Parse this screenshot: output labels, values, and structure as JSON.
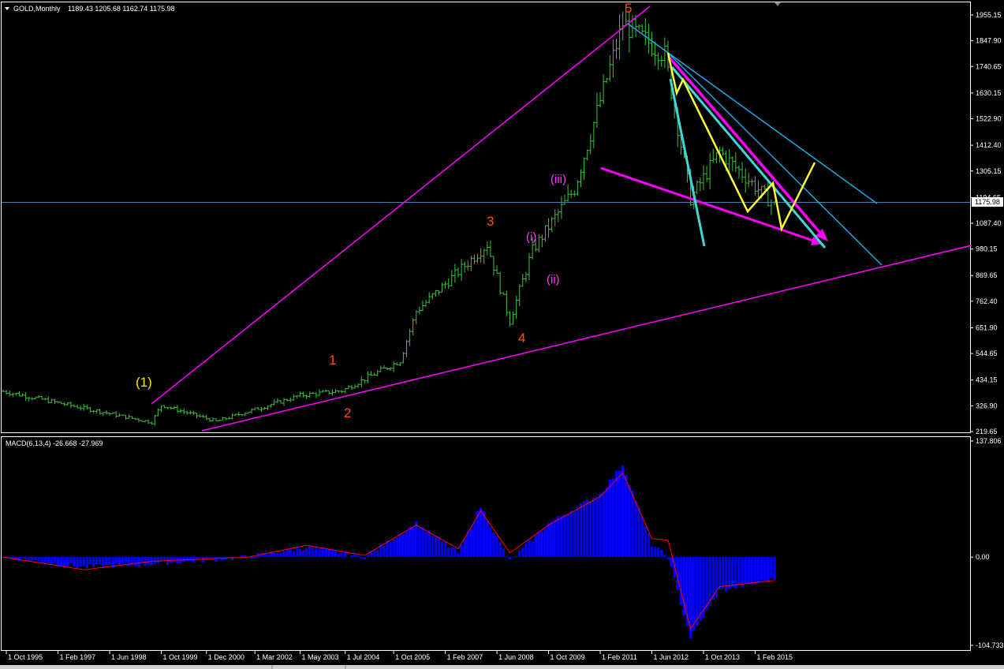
{
  "header": {
    "symbol": "GOLD,Monthly",
    "ohlc": "1189.43 1205.68 1162.74 1175.98",
    "macd_label": "MACD(6,13,4) -26.668 -27.969"
  },
  "colors": {
    "background": "#000000",
    "bar": "#3fbf3f",
    "grid_border": "#ffffff",
    "magenta": "#ff00ff",
    "light_blue": "#1ea7e6",
    "cyan": "#3fd8d8",
    "yellow": "#ffff33",
    "orange_label": "#ff4c1a",
    "yellow_label": "#ffe600",
    "macd_hist": "#0000ff",
    "macd_signal": "#ff0000",
    "current_price_line": "#4682b4"
  },
  "price_axis": {
    "ticks": [
      "1955.15",
      "1847.90",
      "1740.65",
      "1630.15",
      "1522.90",
      "1412.40",
      "1305.15",
      "1194.65",
      "1087.40",
      "980.15",
      "869.65",
      "762.40",
      "651.90",
      "544.65",
      "434.15",
      "326.90",
      "219.65"
    ],
    "current_price": "1175.98"
  },
  "macd_axis": {
    "ticks": [
      "137.806",
      "0.00",
      "-104.733"
    ]
  },
  "time_axis": {
    "labels": [
      "1 Oct 1995",
      "1 Feb 1997",
      "1 Jun 1998",
      "1 Oct 1999",
      "1 Dec 2000",
      "1 Mar 2002",
      "1 May 2003",
      "1 Jul 2004",
      "1 Oct 2005",
      "1 Feb 2007",
      "1 Jun 2008",
      "1 Oct 2009",
      "1 Feb 2011",
      "1 Jun 2012",
      "1 Oct 2013",
      "1 Feb 2015"
    ]
  },
  "wave_labels": {
    "w1_major": "(1)",
    "w1": "1",
    "w2": "2",
    "w3": "3",
    "w4": "4",
    "w5": "5",
    "wi": "(i)",
    "wii": "(ii)",
    "wiii": "(iii)"
  },
  "chart_data": [
    {
      "type": "bar",
      "title": "GOLD,Monthly",
      "x_range": [
        "1995-09",
        "2015-08"
      ],
      "ylim": [
        219.65,
        1955.15
      ],
      "ohlc_last": {
        "open": 1189.43,
        "high": 1205.68,
        "low": 1162.74,
        "close": 1175.98
      },
      "key_points": [
        {
          "x": "1995-09",
          "y": 387
        },
        {
          "x": "1999-07",
          "y": 258
        },
        {
          "x": "1999-10",
          "y": 330
        },
        {
          "x": "2001-03",
          "y": 262
        },
        {
          "x": "2003-05",
          "y": 370
        },
        {
          "x": "2004-06",
          "y": 390
        },
        {
          "x": "2005-12",
          "y": 515
        },
        {
          "x": "2006-05",
          "y": 720
        },
        {
          "x": "2008-03",
          "y": 1000
        },
        {
          "x": "2008-10",
          "y": 680
        },
        {
          "x": "2009-05",
          "y": 975
        },
        {
          "x": "2010-06",
          "y": 1230
        },
        {
          "x": "2011-09",
          "y": 1920
        },
        {
          "x": "2012-10",
          "y": 1790
        },
        {
          "x": "2013-06",
          "y": 1190
        },
        {
          "x": "2014-03",
          "y": 1385
        },
        {
          "x": "2015-07",
          "y": 1176
        }
      ]
    },
    {
      "type": "bar",
      "title": "MACD(6,13,4) -26.668 -27.969",
      "ylim": [
        -104.733,
        137.806
      ],
      "series": [
        {
          "name": "MACD",
          "x": [
            "1995-09",
            "1997-10",
            "1999-07",
            "2002-01",
            "2003-07",
            "2005-01",
            "2006-05",
            "2007-06",
            "2008-01",
            "2008-10",
            "2009-10",
            "2011-02",
            "2011-09",
            "2012-06",
            "2012-11",
            "2013-06",
            "2014-03",
            "2015-07"
          ],
          "values": [
            0,
            -12,
            -8,
            0,
            12,
            0,
            40,
            5,
            60,
            -5,
            40,
            75,
            110,
            15,
            0,
            -95,
            -40,
            -27
          ]
        },
        {
          "name": "Signal",
          "x": [
            "1995-09",
            "1997-10",
            "1999-07",
            "2002-01",
            "2003-07",
            "2005-01",
            "2006-05",
            "2007-06",
            "2008-01",
            "2008-10",
            "2009-10",
            "2011-02",
            "2011-09",
            "2012-06",
            "2012-11",
            "2013-06",
            "2014-03",
            "2015-07"
          ],
          "values": [
            0,
            -15,
            -5,
            0,
            14,
            2,
            38,
            10,
            55,
            5,
            38,
            72,
            100,
            22,
            20,
            -85,
            -35,
            -28
          ]
        }
      ]
    }
  ]
}
